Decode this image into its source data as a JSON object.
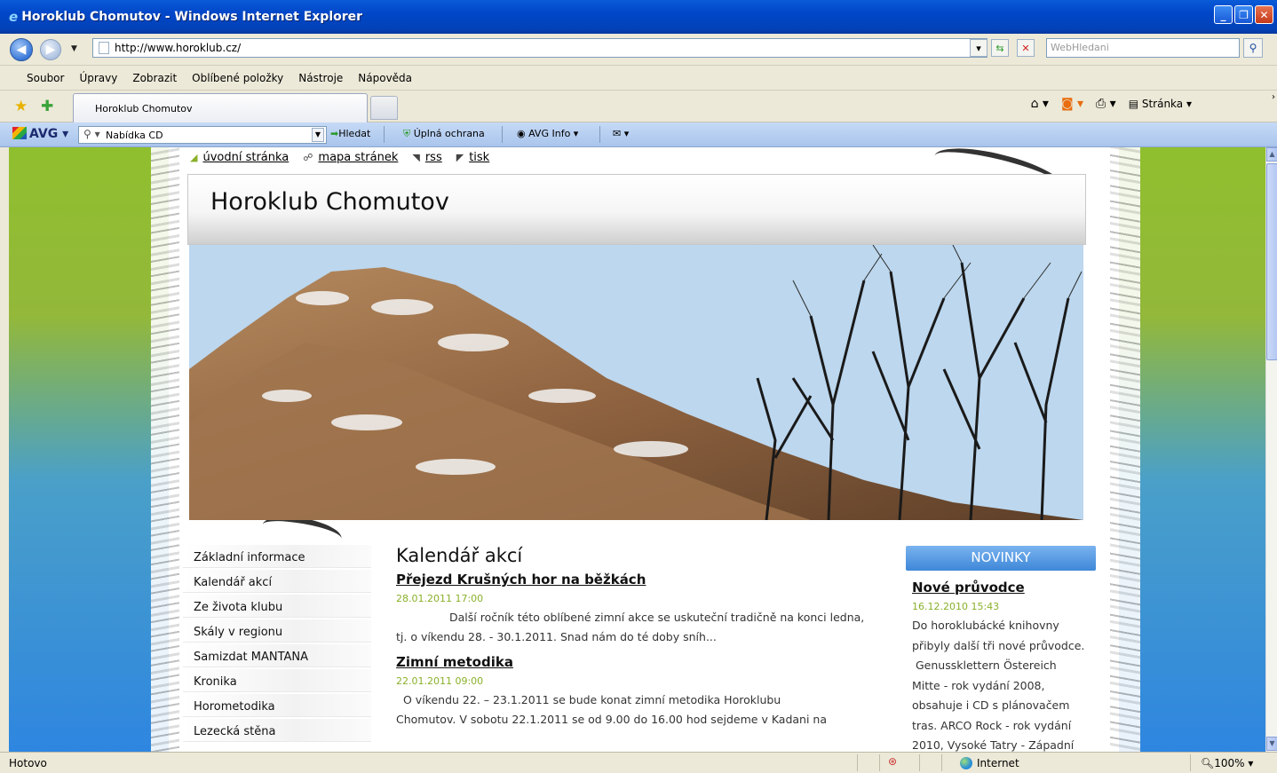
{
  "window": {
    "title": "Horoklub Chomutov - Windows Internet Explorer"
  },
  "address_bar": {
    "url": "http://www.horoklub.cz/",
    "search_placeholder": "WebHledani"
  },
  "menu": {
    "items": [
      "Soubor",
      "Úpravy",
      "Zobrazit",
      "Oblíbené položky",
      "Nástroje",
      "Nápověda"
    ]
  },
  "tabs": {
    "active_label": "Horoklub Chomutov"
  },
  "command_bar": {
    "page_label": "Stránka"
  },
  "avg_toolbar": {
    "logo": "AVG",
    "search_value": "Nabídka CD",
    "search_button": "Hledat",
    "protection": "Úplná ochrana",
    "info": "AVG Info"
  },
  "page": {
    "top_links": [
      "úvodní stránka",
      "mapa stránek",
      "rss",
      "tisk"
    ],
    "site_title": "Horoklub Chomutov",
    "nav": [
      "Základní informace",
      "Kalendář akcí",
      "Ze života klubu",
      "Skály v regionu",
      "Samizdat MANTANA",
      "Kronika",
      "Horometodika",
      "Lezecká stěna"
    ],
    "section_title": "Kalendář akcí",
    "articles": [
      {
        "title": "Přejezd Krušných hor na běžkách",
        "date": "28.01.2011 17:00",
        "line1": "Další ročník této oblíbené zimní akce se uskuteční tradičně na konci ledna,",
        "line2": "tj. o víkendu 28. - 30.1.2011. Snad nám do té doby sníh..."
      },
      {
        "title": "Zimní metodika",
        "date": "22.01.2011 09:00",
        "line1": "O víkendu 22. – 23.1.2011 se bude konat zimní metodika Horoklubu",
        "line2": "Chomutov. V sobotu 22.1.2011 se od 9.00 do 16.00 hod sejdeme v Kadani na"
      }
    ],
    "news": {
      "header": "NOVINKY",
      "title": "Nové průvodce",
      "date": "16.12.2010 15:43",
      "lines": [
        "Do horoklubácké knihovny",
        "přibyly další tři nové průvodce.",
        "Genussklettern Östereich",
        "Mitte - rok vydání 2008,",
        "obsahuje i CD s plánovačem",
        "tras. ARCO Rock - rok vydání",
        "2010, Vysoké Tatry - Západní"
      ]
    }
  },
  "status": {
    "text": "Hotovo",
    "zone": "Internet",
    "zoom": "100%"
  }
}
